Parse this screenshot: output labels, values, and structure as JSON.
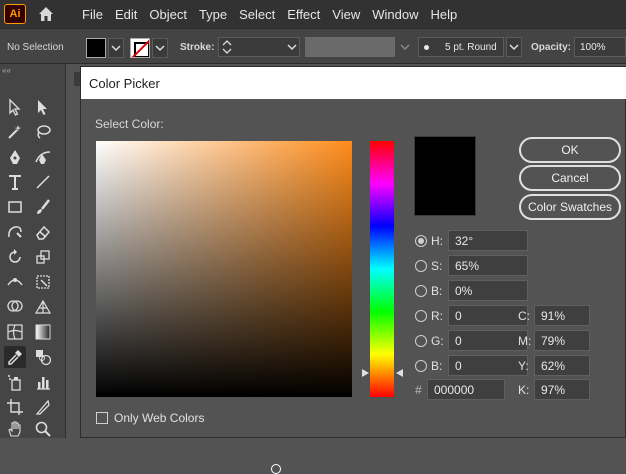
{
  "menubar": {
    "logo": "Ai",
    "items": [
      "File",
      "Edit",
      "Object",
      "Type",
      "Select",
      "Effect",
      "View",
      "Window",
      "Help"
    ]
  },
  "controlbar": {
    "selection": "No Selection",
    "stroke_label": "Stroke:",
    "brush": "5 pt. Round",
    "opacity_label": "Opacity:",
    "opacity_value": "100%"
  },
  "dialog": {
    "title": "Color Picker",
    "select_color": "Select Color:",
    "buttons": {
      "ok": "OK",
      "cancel": "Cancel",
      "swatches": "Color Swatches"
    },
    "hsb": [
      {
        "label": "H:",
        "value": "32°",
        "selected": true
      },
      {
        "label": "S:",
        "value": "65%",
        "selected": false
      },
      {
        "label": "B:",
        "value": "0%",
        "selected": false
      }
    ],
    "rgb": [
      {
        "label": "R:",
        "value": "0"
      },
      {
        "label": "G:",
        "value": "0"
      },
      {
        "label": "B:",
        "value": "0"
      }
    ],
    "hex_label": "#",
    "hex": "000000",
    "cmyk": [
      {
        "label": "C:",
        "value": "91%"
      },
      {
        "label": "M:",
        "value": "79%"
      },
      {
        "label": "Y:",
        "value": "62%"
      },
      {
        "label": "K:",
        "value": "97%"
      }
    ],
    "only_web_colors": "Only Web Colors"
  },
  "colors": {
    "selected_color": "#000000",
    "hue_color": "#ff8c1a",
    "accent_logo": "#ff9a00"
  }
}
